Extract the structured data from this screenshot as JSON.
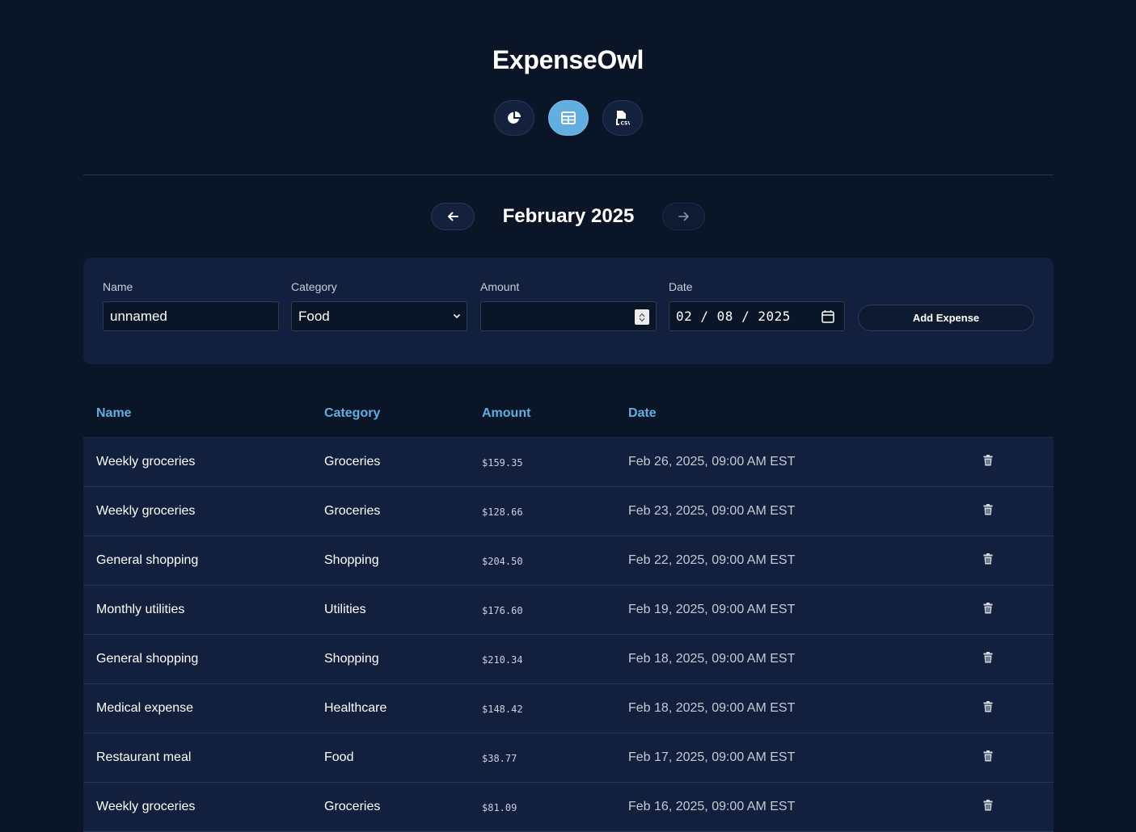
{
  "app": {
    "title": "ExpenseOwl"
  },
  "nav": {
    "buttons": [
      {
        "name": "dashboard",
        "icon": "pie-chart-icon",
        "active": false
      },
      {
        "name": "table",
        "icon": "table-icon",
        "active": true
      },
      {
        "name": "export",
        "icon": "csv-file-icon",
        "active": false
      }
    ]
  },
  "month_nav": {
    "label": "February 2025",
    "prev_icon": "arrow-left-icon",
    "next_icon": "arrow-right-icon"
  },
  "form": {
    "name_label": "Name",
    "name_value": "unnamed",
    "category_label": "Category",
    "category_value": "Food",
    "amount_label": "Amount",
    "amount_value": "",
    "date_label": "Date",
    "date_value": "02 / 08 / 2025",
    "submit_label": "Add Expense"
  },
  "table": {
    "headers": {
      "name": "Name",
      "category": "Category",
      "amount": "Amount",
      "date": "Date"
    },
    "rows": [
      {
        "name": "Weekly groceries",
        "category": "Groceries",
        "amount": "$159.35",
        "date": "Feb 26, 2025, 09:00 AM EST"
      },
      {
        "name": "Weekly groceries",
        "category": "Groceries",
        "amount": "$128.66",
        "date": "Feb 23, 2025, 09:00 AM EST"
      },
      {
        "name": "General shopping",
        "category": "Shopping",
        "amount": "$204.50",
        "date": "Feb 22, 2025, 09:00 AM EST"
      },
      {
        "name": "Monthly utilities",
        "category": "Utilities",
        "amount": "$176.60",
        "date": "Feb 19, 2025, 09:00 AM EST"
      },
      {
        "name": "General shopping",
        "category": "Shopping",
        "amount": "$210.34",
        "date": "Feb 18, 2025, 09:00 AM EST"
      },
      {
        "name": "Medical expense",
        "category": "Healthcare",
        "amount": "$148.42",
        "date": "Feb 18, 2025, 09:00 AM EST"
      },
      {
        "name": "Restaurant meal",
        "category": "Food",
        "amount": "$38.77",
        "date": "Feb 17, 2025, 09:00 AM EST"
      },
      {
        "name": "Weekly groceries",
        "category": "Groceries",
        "amount": "$81.09",
        "date": "Feb 16, 2025, 09:00 AM EST"
      }
    ]
  },
  "colors": {
    "background": "#0a1628",
    "panel": "#12203d",
    "accent": "#63aee0"
  }
}
